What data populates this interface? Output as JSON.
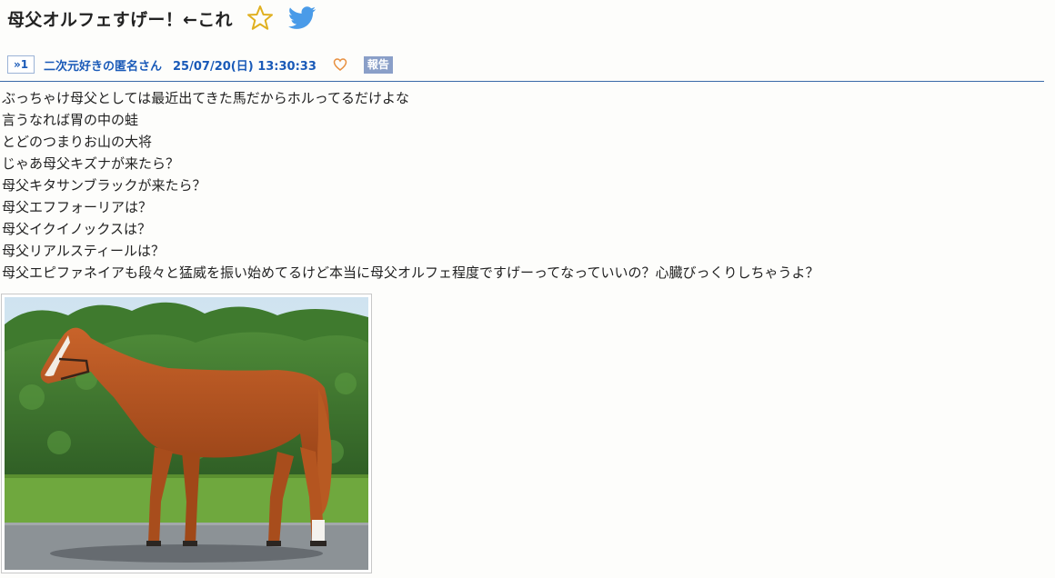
{
  "thread": {
    "title": "母父オルフェすげー！←これ",
    "favorite_icon": "star-outline-icon",
    "share_icon": "twitter-icon"
  },
  "post": {
    "number": "»1",
    "poster_name": "二次元好きの匿名さん",
    "date": "25/07/20(日) 13:30:33",
    "like_icon": "heart-outline-icon",
    "report_label": "報告",
    "lines": [
      "ぶっちゃけ母父としては最近出てきた馬だからホルってるだけよな",
      "言うなれば胃の中の蛙",
      "とどのつまりお山の大将",
      "じゃあ母父キズナが来たら？",
      "母父キタサンブラックが来たら？",
      "母父エフフォーリアは？",
      "母父イクイノックスは？",
      "母父リアルスティールは？",
      "母父エピファネイアも段々と猛威を振い始めてるけど本当に母父オルフェ程度ですげーってなっていいの？心臓びっくりしちゃうよ？"
    ],
    "image": "chestnut-horse-photo"
  },
  "colors": {
    "link_blue": "#1a5ab8",
    "report_bg": "#8a9fc8",
    "star_gold": "#e0b020",
    "twitter_blue": "#4a9be8",
    "heart_orange": "#e89040"
  }
}
